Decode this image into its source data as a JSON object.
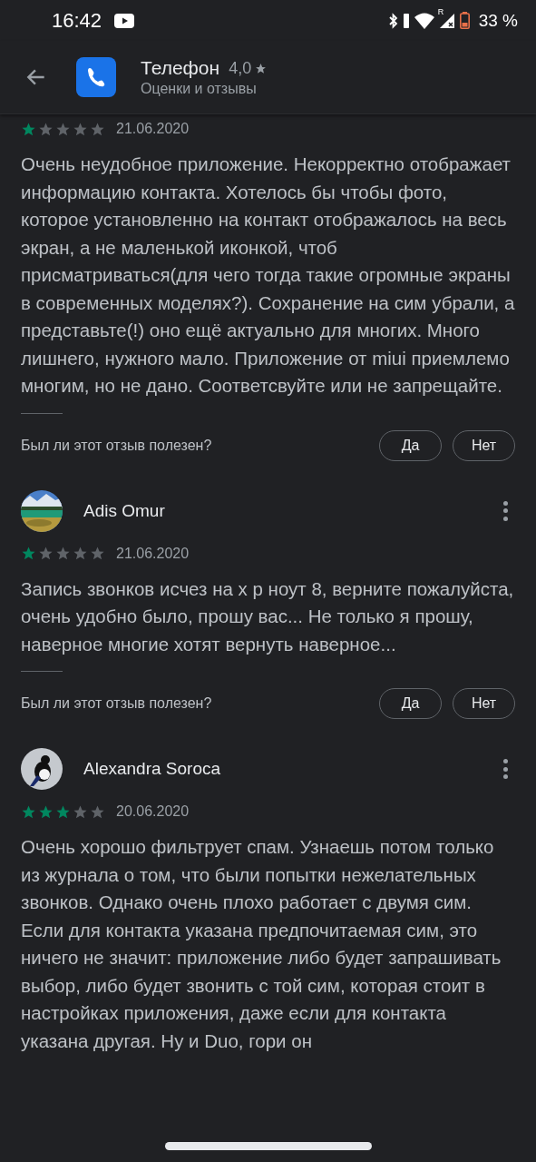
{
  "status_bar": {
    "time": "16:42",
    "roaming_mark": "R",
    "battery_text": "33 %"
  },
  "header": {
    "app_name": "Телефон",
    "rating": "4,0",
    "subtitle": "Оценки и отзывы"
  },
  "reviews": [
    {
      "stars": 1,
      "date": "21.06.2020",
      "text": "Очень неудобное приложение. Некорректно отображает информацию контакта. Хотелось бы чтобы фото, которое установленно на контакт отображалось на весь экран, а не маленькой иконкой, чтоб присматриваться(для чего тогда такие огромные экраны в современных моделях?). Сохранение на сим убрали, а представьте(!) оно ещё актуально для многих. Много лишнего, нужного мало. Приложение от miui приемлемо многим, но не дано. Соответсвуйте или не запрещайте.",
      "helpful_question": "Был ли этот отзыв полезен?",
      "yes": "Да",
      "no": "Нет"
    },
    {
      "author": "Adis Omur",
      "stars": 1,
      "date": "21.06.2020",
      "text": "Запись звонков исчез на х р ноут 8, верните пожалуйста, очень удобно было, прошу вас... Не только я прошу, наверное многие хотят вернуть наверное...",
      "helpful_question": "Был ли этот отзыв полезен?",
      "yes": "Да",
      "no": "Нет"
    },
    {
      "author": "Alexandra Soroca",
      "stars": 3,
      "date": "20.06.2020",
      "text": "Очень хорошо фильтрует спам. Узнаешь потом только из журнала о том, что были попытки нежелательных звонков. Однако очень плохо работает с двумя сим. Если для контакта указана предпочитаемая сим, это ничего не значит: приложение либо будет запрашивать выбор, либо будет звонить с той сим, которая стоит в настройках приложения, даже если для контакта указана другая. Ну и Duo, гори он"
    }
  ]
}
